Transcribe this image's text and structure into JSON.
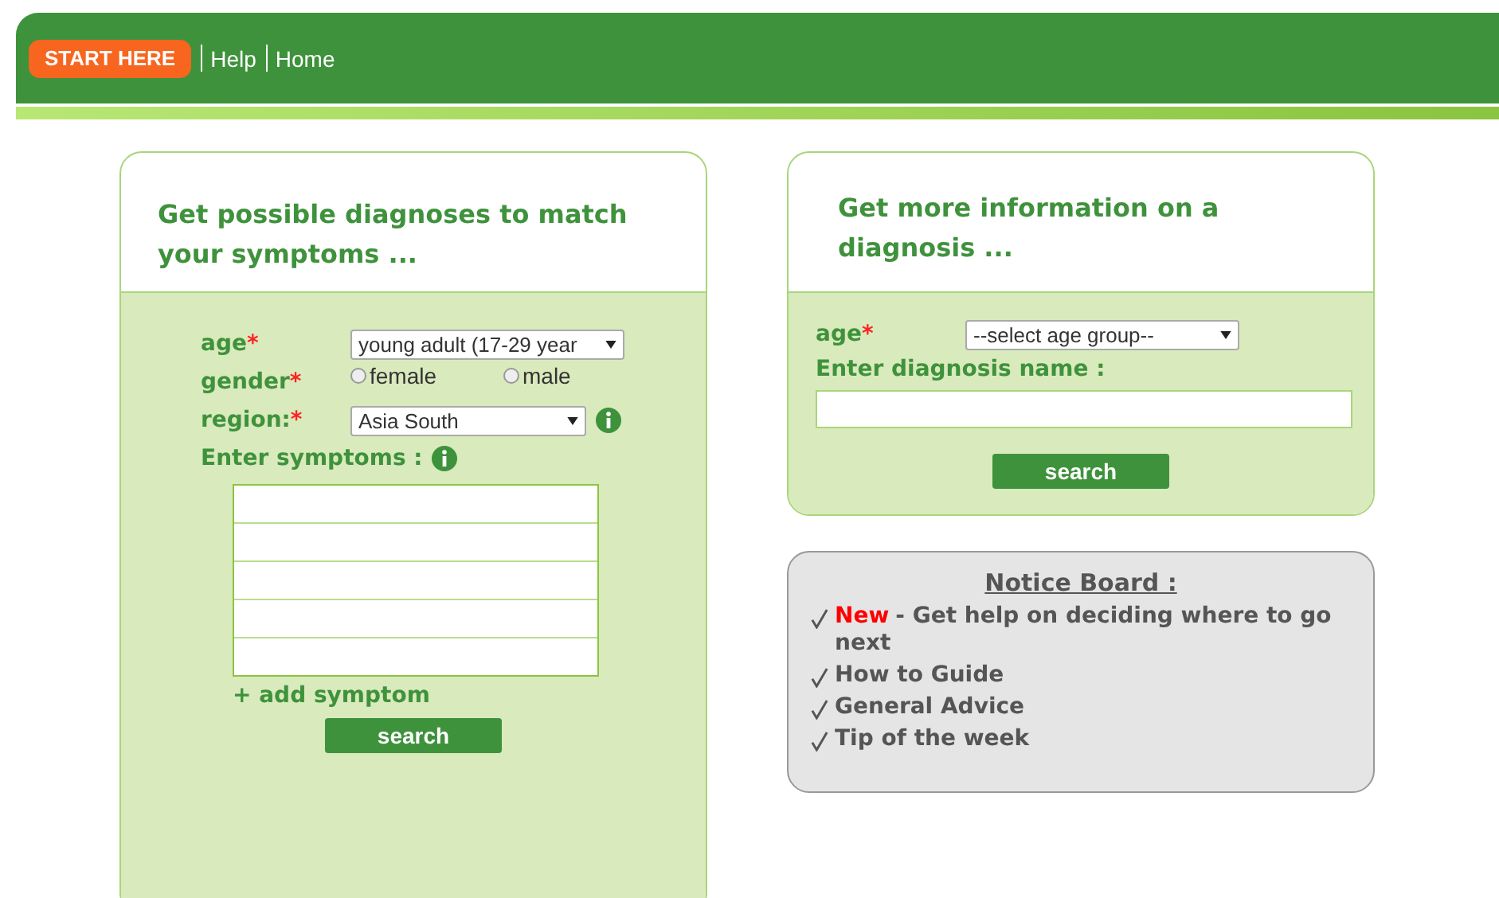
{
  "nav": {
    "start_button": "START HERE",
    "links": [
      "Help",
      "Home"
    ]
  },
  "symptom_form": {
    "title": "Get possible diagnoses to match your symptoms ...",
    "age": {
      "label": "age",
      "required_mark": "*",
      "value": "young adult (17-29 year"
    },
    "gender": {
      "label": "gender",
      "required_mark": "*",
      "options": [
        {
          "label": "female",
          "selected": false
        },
        {
          "label": "male",
          "selected": false
        }
      ]
    },
    "region": {
      "label": "region:",
      "required_mark": "*",
      "value": "Asia South"
    },
    "symptoms_label": "Enter symptoms :",
    "add_link": "+ add symptom",
    "button": "search"
  },
  "diagnosis_form": {
    "title": "Get more information on a diagnosis ...",
    "age": {
      "label": "age",
      "required_mark": "*",
      "value": "--select age group--"
    },
    "name_label": "Enter diagnosis name :",
    "button": "search"
  },
  "notice_board": {
    "title": "Notice Board :",
    "items": [
      {
        "tag": "New",
        "text": "- Get help on deciding where to go next"
      },
      {
        "text": "How to Guide"
      },
      {
        "text": "General Advice"
      },
      {
        "text": "Tip of the week"
      }
    ]
  }
}
